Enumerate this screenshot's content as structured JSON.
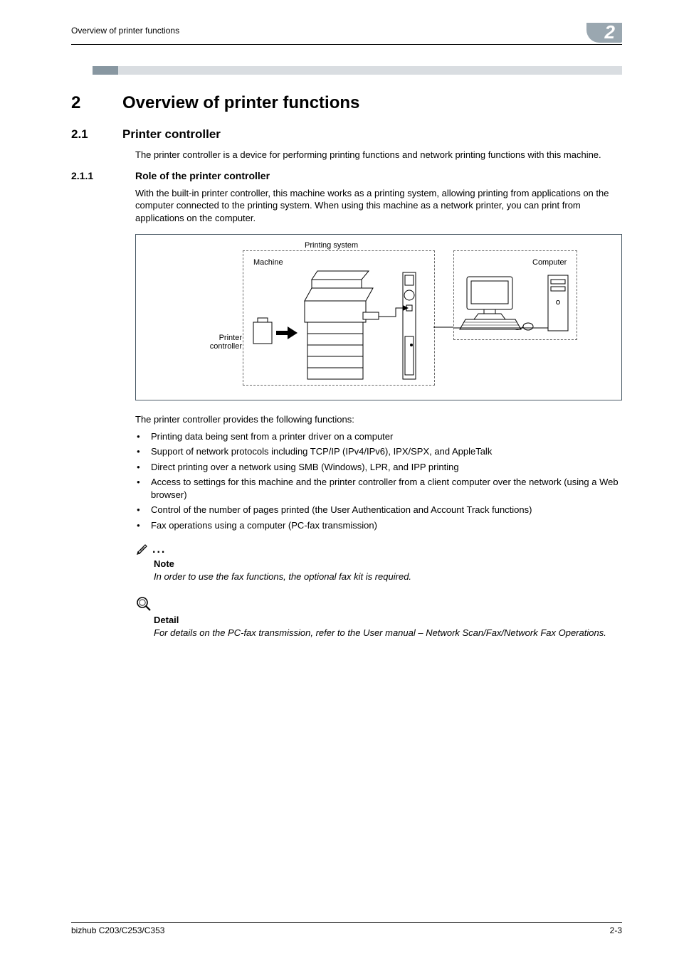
{
  "header": {
    "running_head": "Overview of printer functions",
    "chapter_badge": "2"
  },
  "chapter": {
    "number": "2",
    "title": "Overview of printer functions"
  },
  "section": {
    "number": "2.1",
    "title": "Printer controller",
    "intro": "The printer controller is a device for performing printing functions and network printing functions with this machine."
  },
  "subsection": {
    "number": "2.1.1",
    "title": "Role of the printer controller",
    "intro": "With the built-in printer controller, this machine works as a printing system, allowing printing from applications on the computer connected to the printing system. When using this machine as a network printer, you can print from applications on the computer."
  },
  "diagram": {
    "label_printing_system": "Printing system",
    "label_machine": "Machine",
    "label_computer": "Computer",
    "label_printer_controller": "Printer controller"
  },
  "functions_intro": "The printer controller provides the following functions:",
  "functions": [
    "Printing data being sent from a printer driver on a computer",
    "Support of network protocols including TCP/IP (IPv4/IPv6), IPX/SPX, and AppleTalk",
    "Direct printing over a network using SMB (Windows), LPR, and IPP printing",
    "Access to settings for this machine and the printer controller from a client computer over the network (using a Web browser)",
    "Control of the number of pages printed (the User Authentication and Account Track functions)",
    "Fax operations using a computer (PC-fax transmission)"
  ],
  "note": {
    "heading": "Note",
    "text": "In order to use the fax functions, the optional fax kit is required."
  },
  "detail": {
    "heading": "Detail",
    "text": "For details on the PC-fax transmission, refer to the User manual – Network Scan/Fax/Network Fax Operations."
  },
  "footer": {
    "left": "bizhub C203/C253/C353",
    "right": "2-3"
  }
}
